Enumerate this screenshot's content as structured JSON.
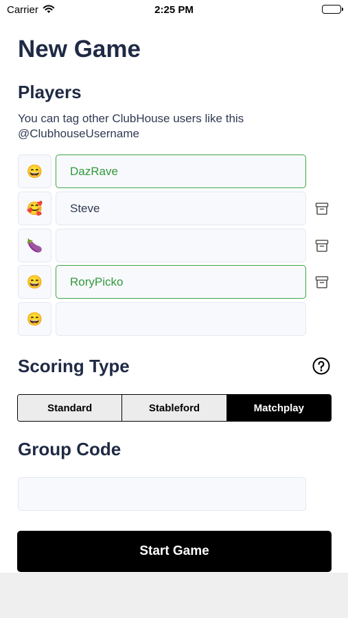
{
  "status_bar": {
    "carrier": "Carrier",
    "time": "2:25 PM"
  },
  "page_title": "New Game",
  "players": {
    "title": "Players",
    "help_text": "You can tag other ClubHouse users like this @ClubhouseUsername",
    "rows": [
      {
        "emoji": "😄",
        "name": "DazRave",
        "active": true,
        "deletable": false
      },
      {
        "emoji": "🥰",
        "name": "Steve",
        "active": false,
        "deletable": true
      },
      {
        "emoji": "🍆",
        "name": "",
        "active": false,
        "deletable": true
      },
      {
        "emoji": "😄",
        "name": "RoryPicko",
        "active": true,
        "deletable": true
      },
      {
        "emoji": "😄",
        "name": "",
        "active": false,
        "deletable": false
      }
    ]
  },
  "scoring": {
    "title": "Scoring Type",
    "options": [
      "Standard",
      "Stableford",
      "Matchplay"
    ],
    "selected": "Matchplay"
  },
  "group_code": {
    "title": "Group Code",
    "value": ""
  },
  "start_button": "Start Game",
  "colors": {
    "active_border": "#3aa545",
    "active_text": "#2f9a3b",
    "title": "#1f2a44"
  }
}
